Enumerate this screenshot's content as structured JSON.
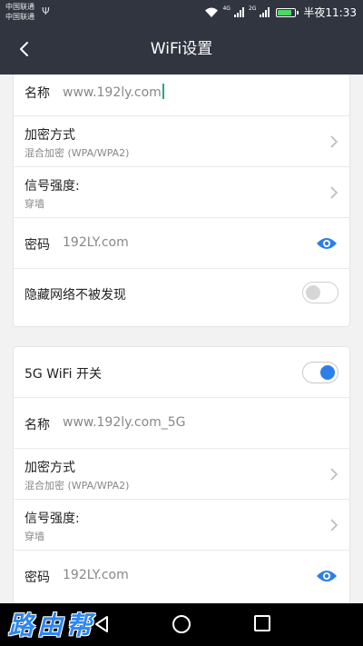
{
  "status_bar": {
    "carrier_1": "中国联通",
    "carrier_2": "中国联通",
    "net_1": "4G",
    "net_2": "2G",
    "time": "半夜11:33",
    "battery_level": 0.8,
    "icons": [
      "usb-icon",
      "wifi-icon",
      "signal-icon",
      "battery-icon"
    ]
  },
  "app_bar": {
    "title": "WiFi设置",
    "back_icon": "chevron-left-icon"
  },
  "wifi_24g": {
    "name_label": "名称",
    "name_value": "www.192ly.com",
    "encryption_label": "加密方式",
    "encryption_value": "混合加密 (WPA/WPA2)",
    "signal_label": "信号强度:",
    "signal_value": "穿墙",
    "password_label": "密码",
    "password_value": "192LY.com",
    "hidden_label": "隐藏网络不被发现",
    "hidden_enabled": false
  },
  "wifi_5g": {
    "switch_label": "5G WiFi 开关",
    "switch_enabled": true,
    "name_label": "名称",
    "name_value": "www.192ly.com_5G",
    "encryption_label": "加密方式",
    "encryption_value": "混合加密 (WPA/WPA2)",
    "signal_label": "信号强度:",
    "signal_value": "穿墙",
    "password_label": "密码",
    "password_value": "192LY.com"
  },
  "watermark": "路由帮",
  "colors": {
    "header_bg": "#303540",
    "accent_blue": "#2d7fe8",
    "cursor_teal": "#2aa198",
    "watermark_blue": "#2c87f0"
  }
}
